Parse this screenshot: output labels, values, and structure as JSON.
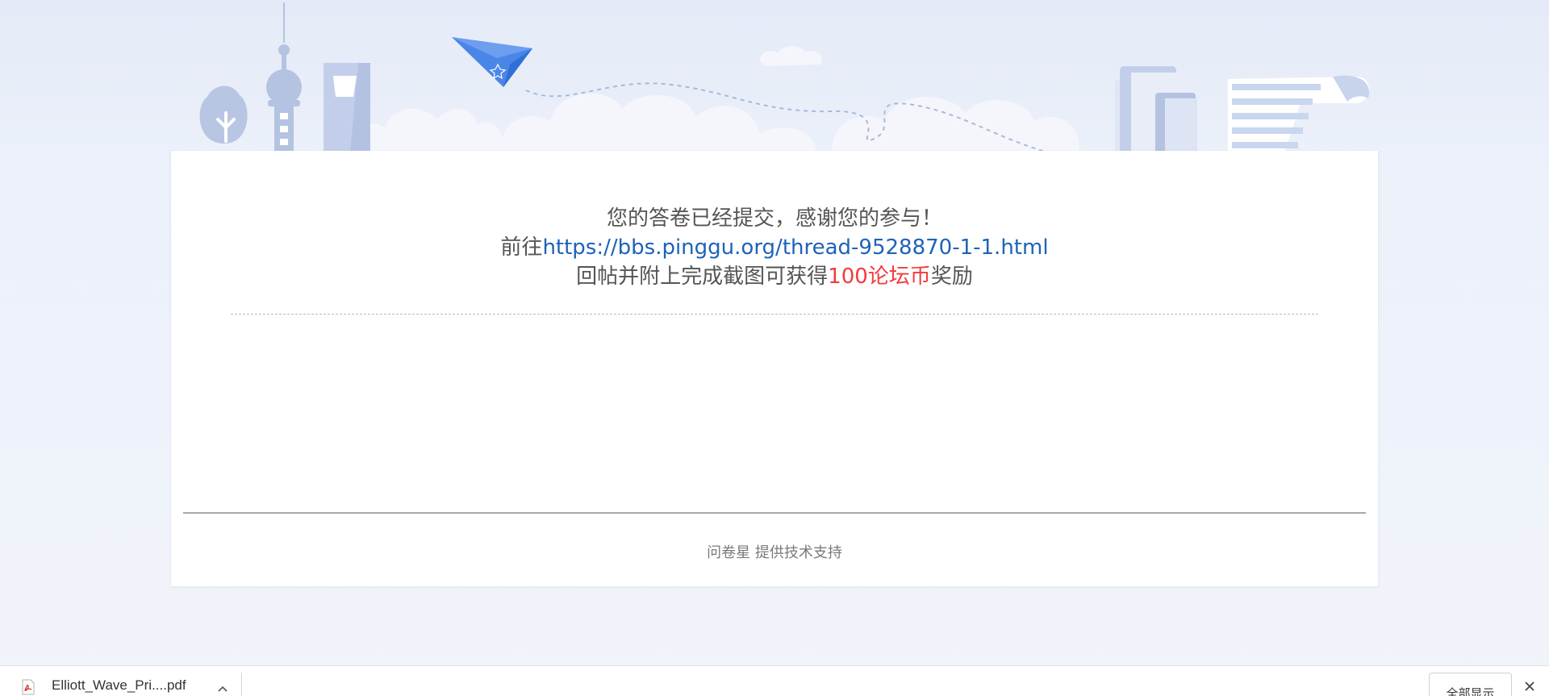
{
  "result": {
    "line1": "您的答卷已经提交，感谢您的参与！",
    "line2_prefix": "前往",
    "link_text": "https://bbs.pinggu.org/thread-9528870-1-1.html",
    "line3_prefix": "回帖并附上完成截图可获得",
    "reward": "100论坛币",
    "line3_suffix": "奖励"
  },
  "footer": {
    "credit": "问卷星 提供技术支持"
  },
  "download_bar": {
    "file_name": "Elliott_Wave_Pri....pdf",
    "show_all_label": "全部显示"
  },
  "colors": {
    "link": "#1d63b8",
    "reward": "#f23b3b",
    "illustration": "#c9d6ef",
    "plane": "#4a86e8"
  },
  "icons": [
    "tree-icon",
    "tv-tower-icon",
    "skyscraper-icon",
    "paper-plane-icon",
    "books-icon",
    "paper-scroll-icon",
    "pdf-icon",
    "chevron-up-icon",
    "close-icon"
  ]
}
